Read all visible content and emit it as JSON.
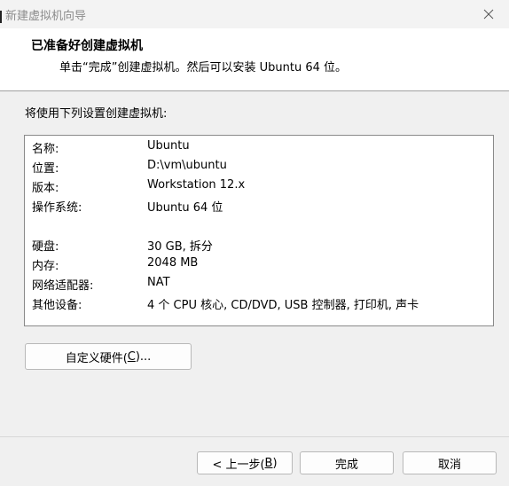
{
  "window": {
    "title": "新建虚拟机向导"
  },
  "header": {
    "title": "已准备好创建虚拟机",
    "subtitle": "单击“完成”创建虚拟机。然后可以安装 Ubuntu 64 位。"
  },
  "intro": "将使用下列设置创建虚拟机:",
  "summary": [
    {
      "key": "名称:",
      "value": "Ubuntu"
    },
    {
      "key": "位置:",
      "value": "D:\\vm\\ubuntu"
    },
    {
      "key": "版本:",
      "value": "Workstation 12.x"
    },
    {
      "key": "操作系统:",
      "value": "Ubuntu 64 位"
    },
    {
      "key": "硬盘:",
      "value": "30 GB, 拆分"
    },
    {
      "key": "内存:",
      "value": "2048 MB"
    },
    {
      "key": "网络适配器:",
      "value": "NAT"
    },
    {
      "key": "其他设备:",
      "value": "4 个 CPU 核心, CD/DVD, USB 控制器, 打印机, 声卡"
    }
  ],
  "buttons": {
    "customize_prefix": "自定义硬件(",
    "customize_key": "C",
    "customize_suffix": ")...",
    "back_prefix": "< 上一步(",
    "back_key": "B",
    "back_suffix": ")",
    "finish": "完成",
    "cancel": "取消"
  },
  "icons": {
    "close": "close-icon"
  }
}
